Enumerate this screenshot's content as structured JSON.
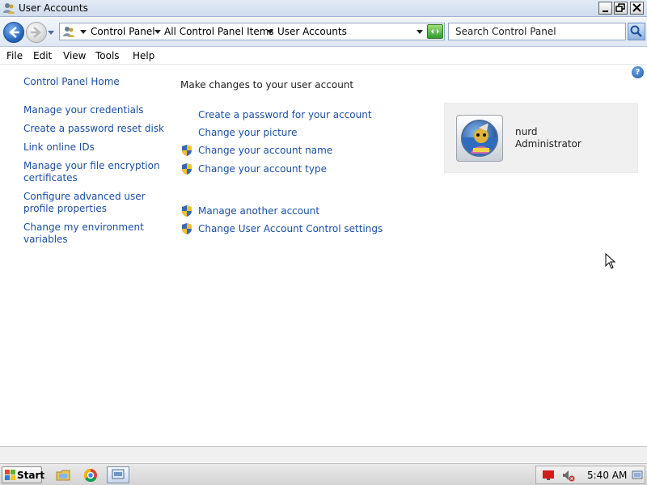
{
  "window": {
    "title": "User Accounts"
  },
  "address_bar": {
    "breadcrumbs": [
      "Control Panel",
      "All Control Panel Items",
      "User Accounts"
    ],
    "search_placeholder": "Search Control Panel"
  },
  "menu": [
    "File",
    "Edit",
    "View",
    "Tools",
    "Help"
  ],
  "sidebar": {
    "home": "Control Panel Home",
    "links": [
      {
        "label": "Manage your credentials"
      },
      {
        "label": "Create a password reset disk"
      },
      {
        "label": "Link online IDs"
      },
      {
        "line1": "Manage your file encryption",
        "line2": "certificates"
      },
      {
        "line1": "Configure advanced user",
        "line2": "profile properties"
      },
      {
        "line1": "Change my environment",
        "line2": "variables"
      }
    ]
  },
  "main": {
    "heading": "Make changes to your user account",
    "tasks": [
      "Create a password for your account",
      "Change your picture",
      "Change your account name",
      "Change your account type"
    ],
    "more_tasks": [
      "Manage another account",
      "Change User Account Control settings"
    ]
  },
  "account": {
    "name": "nurd",
    "role": "Administrator"
  },
  "taskbar": {
    "start_label": "Start",
    "clock": "5:40 AM"
  },
  "icons": {
    "window": "user-accounts-icon",
    "back": "back-arrow-icon",
    "forward": "forward-arrow-icon",
    "refresh": "refresh-icon",
    "search": "magnifier-icon",
    "help": "help-icon",
    "shield": "uac-shield-icon",
    "avatar": "user-picture"
  },
  "colors": {
    "link": "#1b4fa2",
    "panel_bg": "#f0f0f0",
    "titlebar": "#cfdcec"
  }
}
